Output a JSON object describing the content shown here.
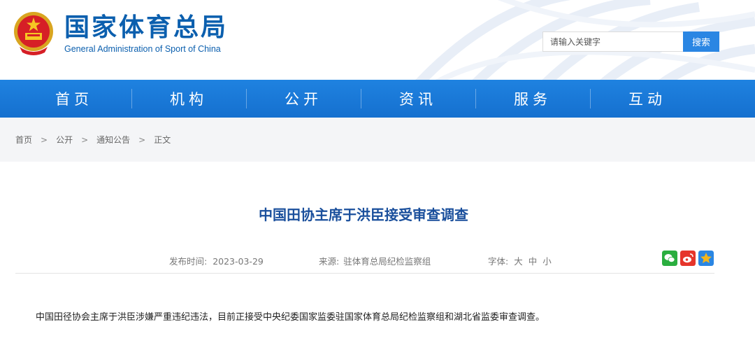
{
  "header": {
    "site_name": "国家体育总局",
    "site_name_en": "General Administration of Sport of China",
    "search_placeholder": "请输入关键字",
    "search_button": "搜索"
  },
  "nav": {
    "items": [
      "首页",
      "机构",
      "公开",
      "资讯",
      "服务",
      "互动"
    ]
  },
  "breadcrumb": {
    "items": [
      "首页",
      "公开",
      "通知公告",
      "正文"
    ],
    "separator": ">"
  },
  "article": {
    "title": "中国田协主席于洪臣接受审查调查",
    "publish_label": "发布时间:",
    "publish_date": "2023-03-29",
    "source_label": "来源:",
    "source": "驻体育总局纪检监察组",
    "font_label": "字体:",
    "font_sizes": [
      "大",
      "中",
      "小"
    ],
    "body": "中国田径协会主席于洪臣涉嫌严重违纪违法，目前正接受中央纪委国家监委驻国家体育总局纪检监察组和湖北省监委审查调查。"
  },
  "share": {
    "icons": [
      "wechat-icon",
      "weibo-icon",
      "qzone-icon"
    ],
    "colors": {
      "wechat": "#2aae3f",
      "weibo": "#e6352b",
      "qzone": "#f2b51c"
    }
  },
  "colors": {
    "brand_blue": "#0b5fae",
    "nav_blue": "#1877d8",
    "title_blue": "#1a4f9c",
    "search_button": "#2a86e3"
  }
}
